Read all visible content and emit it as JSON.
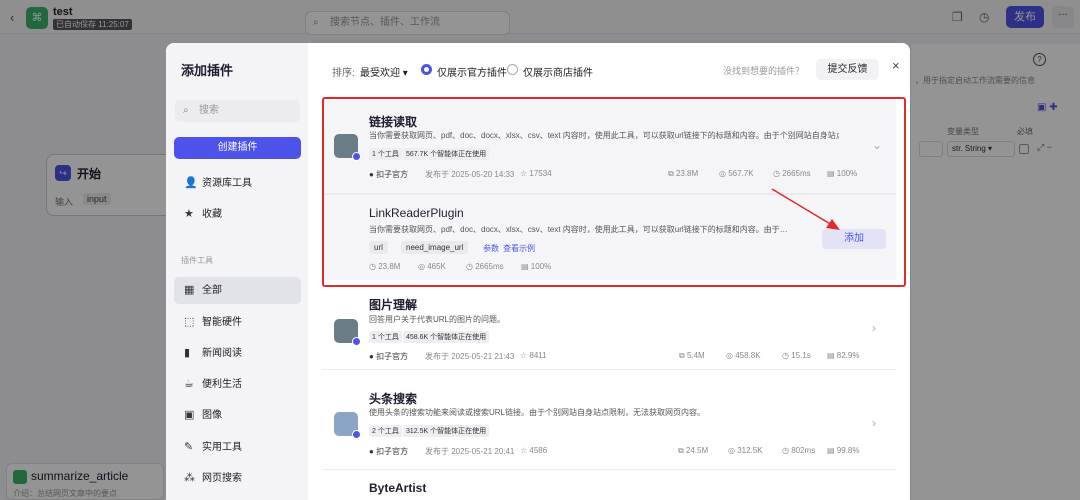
{
  "topbar": {
    "app_icon": "workflow-icon",
    "title": "test",
    "subtitle": "已自动保存 11:25:07",
    "search_placeholder": "搜索节点、插件、工作流",
    "publish_label": "发布",
    "more_label": "..."
  },
  "canvas": {
    "start_node": {
      "title": "开始",
      "input_label": "输入",
      "input_tag": "input"
    },
    "summarize_node": {
      "title": "summarize_article",
      "desc": "介绍：总结网页文章中的要点"
    }
  },
  "right_panel": {
    "hint": "，用于指定启动工作流需要的信息",
    "col_type": "变量类型",
    "col_required": "必填",
    "type_value": "String",
    "type_prefix": "str."
  },
  "modal": {
    "title": "添加插件",
    "search_placeholder": "搜索",
    "create_label": "创建插件",
    "nav_top": [
      {
        "label": "资源库工具",
        "icon": "person-icon"
      },
      {
        "label": "收藏",
        "icon": "star-icon"
      }
    ],
    "section_label": "插件工具",
    "nav_categories": [
      {
        "label": "全部",
        "icon": "grid-icon",
        "active": true
      },
      {
        "label": "智能硬件",
        "icon": "chip-icon"
      },
      {
        "label": "新闻阅读",
        "icon": "book-icon"
      },
      {
        "label": "便利生活",
        "icon": "cup-icon"
      },
      {
        "label": "图像",
        "icon": "image-icon"
      },
      {
        "label": "实用工具",
        "icon": "wrench-icon"
      },
      {
        "label": "网页搜索",
        "icon": "network-icon"
      }
    ],
    "sort_label": "排序:",
    "sort_value": "最受欢迎",
    "filter_official": "仅展示官方插件",
    "filter_store": "仅展示商店插件",
    "missing_text": "没找到想要的插件？",
    "feedback_label": "提交反馈",
    "close_label": "×",
    "plugins": [
      {
        "name": "链接读取",
        "desc": "当你需要获取网页、pdf、doc、docx、xlsx、csv、text 内容时，使用此工具，可以获取url链接下的标题和内容。由于个别网站自身站点…",
        "tools": "1 个工具",
        "using": "567.7K 个智能体正在使用",
        "author": "扣子官方",
        "published": "发布于 2025-05-20 14:33",
        "stars": "17534",
        "tokens": "23.8M",
        "calls": "567.7K",
        "latency": "2665ms",
        "success": "100%",
        "chevron": "⌄"
      },
      {
        "name": "图片理解",
        "desc": "回答用户关于代表URL的图片的问题。",
        "tools": "1 个工具",
        "using": "458.6K 个智能体正在使用",
        "author": "扣子官方",
        "published": "发布于 2025-05-21 21:43",
        "stars": "8411",
        "tokens": "5.4M",
        "calls": "458.8K",
        "latency": "15.1s",
        "success": "82.9%",
        "chevron": "›"
      },
      {
        "name": "头条搜索",
        "desc": "使用头条的搜索功能来阅读或搜索URL链接。由于个别网站自身站点限制，无法获取网页内容。",
        "tools": "2 个工具",
        "using": "312.5K 个智能体正在使用",
        "author": "扣子官方",
        "published": "发布于 2025-05-21 20:41",
        "stars": "4586",
        "tokens": "24.5M",
        "calls": "312.5K",
        "latency": "802ms",
        "success": "99.8%",
        "chevron": "›"
      },
      {
        "name": "ByteArtist"
      }
    ],
    "subtool": {
      "name": "LinkReaderPlugin",
      "desc": "当你需要获取网页、pdf、doc、docx、xlsx、csv、text 内容时，使用此工具，可以获取url链接下的标题和内容。由于…",
      "params": [
        "url",
        "need_image_url"
      ],
      "params_label": "参数",
      "example_label": "查看示例",
      "tokens": "23.8M",
      "calls": "465K",
      "latency": "2665ms",
      "success": "100%",
      "add_label": "添加"
    }
  },
  "colors": {
    "accent": "#4d53e8",
    "highlight_box": "#e02a2a",
    "brand_green": "#3bb36a"
  }
}
